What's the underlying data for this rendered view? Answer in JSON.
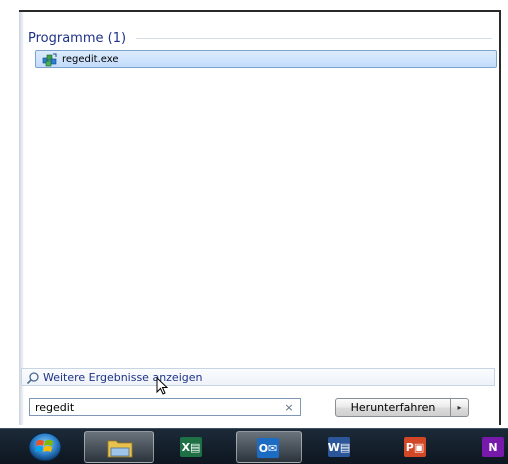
{
  "results": {
    "group_title": "Programme (1)",
    "item_label": "regedit.exe",
    "item_icon": "regedit-icon"
  },
  "more_results": {
    "label": "Weitere Ergebnisse anzeigen",
    "icon": "magnifier-icon"
  },
  "search": {
    "value": "regedit",
    "clear_glyph": "×"
  },
  "shutdown": {
    "label": "Herunterfahren",
    "arrow_glyph": "▸"
  },
  "taskbar": {
    "items": [
      {
        "name": "start-orb",
        "icon": "windows-orb-icon"
      },
      {
        "name": "explorer",
        "icon": "folder-icon",
        "active": true
      },
      {
        "name": "excel",
        "icon": "excel-icon",
        "letter": "X",
        "color": "#1e7145"
      },
      {
        "name": "outlook",
        "icon": "outlook-icon",
        "letter": "O",
        "color": "#1c6cc4",
        "active": true
      },
      {
        "name": "word",
        "icon": "word-icon",
        "letter": "W",
        "color": "#2b579a"
      },
      {
        "name": "powerpoint",
        "icon": "powerpoint-icon",
        "letter": "P",
        "color": "#d24726"
      },
      {
        "name": "onenote",
        "icon": "onenote-icon",
        "letter": "N",
        "color": "#7719aa"
      }
    ]
  },
  "colors": {
    "accent_text": "#1e3287",
    "selection_fill": "#c2dcfb",
    "selection_border": "#7da2ce"
  }
}
